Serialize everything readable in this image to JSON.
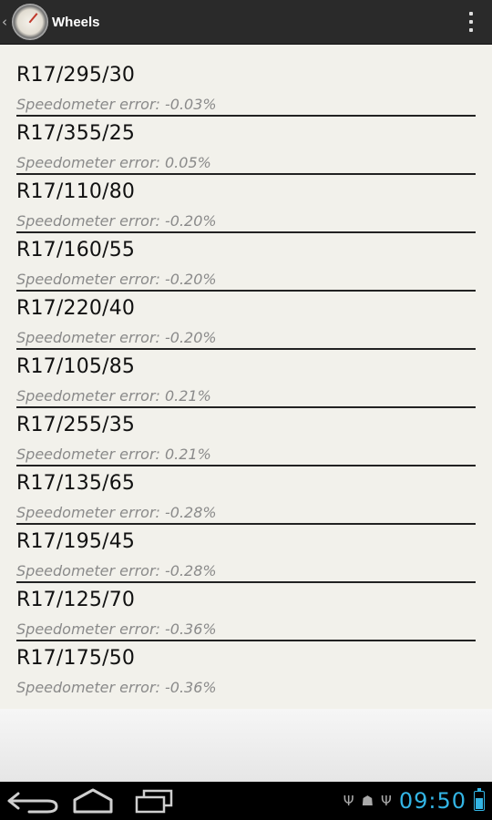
{
  "actionbar": {
    "title": "Wheels",
    "up_icon": "chevron-left-icon",
    "app_icon": "speedometer-icon",
    "overflow_icon": "more-vertical-icon"
  },
  "wheels": [
    {
      "size": "R17/295/30",
      "error": "Speedometer error: -0.03%"
    },
    {
      "size": "R17/355/25",
      "error": "Speedometer error: 0.05%"
    },
    {
      "size": "R17/110/80",
      "error": "Speedometer error: -0.20%"
    },
    {
      "size": "R17/160/55",
      "error": "Speedometer error: -0.20%"
    },
    {
      "size": "R17/220/40",
      "error": "Speedometer error: -0.20%"
    },
    {
      "size": "R17/105/85",
      "error": "Speedometer error: 0.21%"
    },
    {
      "size": "R17/255/35",
      "error": "Speedometer error: 0.21%"
    },
    {
      "size": "R17/135/65",
      "error": "Speedometer error: -0.28%"
    },
    {
      "size": "R17/195/45",
      "error": "Speedometer error: -0.28%"
    },
    {
      "size": "R17/125/70",
      "error": "Speedometer error: -0.36%"
    },
    {
      "size": "R17/175/50",
      "error": "Speedometer error: -0.36%"
    }
  ],
  "navbar": {
    "back_icon": "back-icon",
    "home_icon": "home-icon",
    "recent_icon": "recent-apps-icon"
  },
  "status": {
    "time": "09:50",
    "icons": [
      "usb-icon",
      "android-debug-icon",
      "usb-icon",
      "battery-icon"
    ],
    "accent": "#33b5e5"
  }
}
